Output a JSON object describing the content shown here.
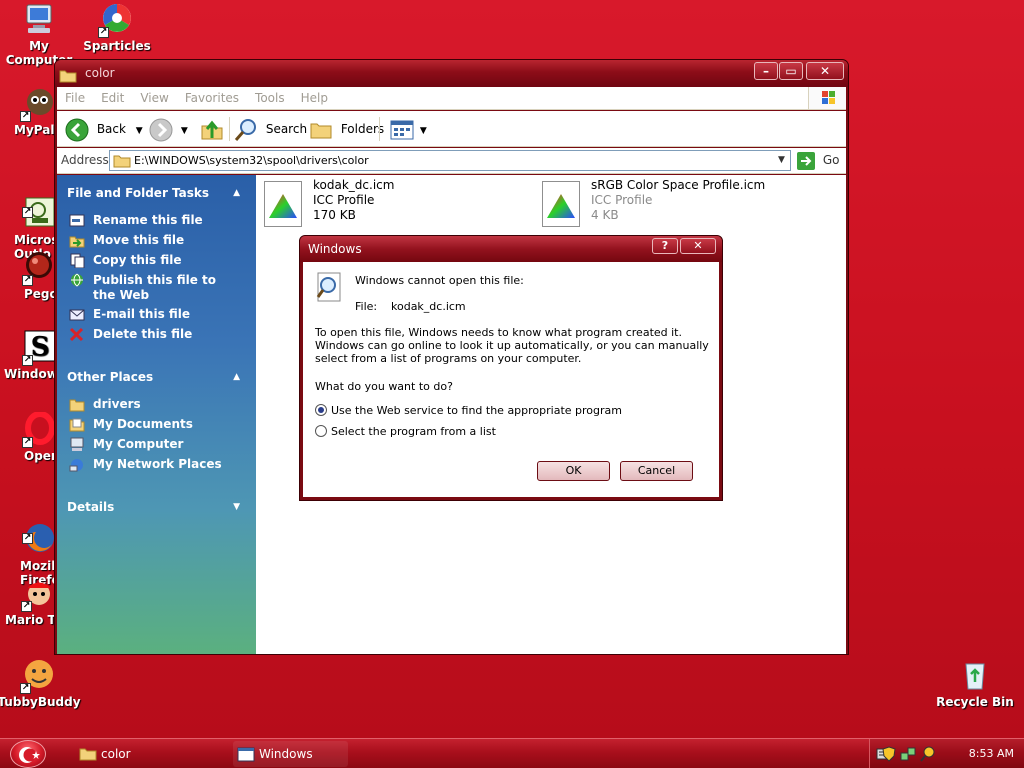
{
  "desktop": {
    "icons": [
      {
        "label": "My Computer"
      },
      {
        "label": "Sparticles"
      },
      {
        "label": "MyPal"
      },
      {
        "label": "Micros\nOutlo"
      },
      {
        "label": "Pego"
      },
      {
        "label": "Windows"
      },
      {
        "label": "Opera"
      },
      {
        "label": "Mozill\nFirefo"
      },
      {
        "label": "Mario Te"
      },
      {
        "label": "TubbyBuddy"
      },
      {
        "label": "Recycle Bin"
      }
    ]
  },
  "explorer": {
    "title": "color",
    "menu": [
      "File",
      "Edit",
      "View",
      "Favorites",
      "Tools",
      "Help"
    ],
    "toolbar": {
      "back": "Back",
      "search": "Search",
      "folders": "Folders"
    },
    "address": {
      "label": "Address",
      "path": "E:\\WINDOWS\\system32\\spool\\drivers\\color",
      "go": "Go"
    },
    "tasks": {
      "file_folder_title": "File and Folder Tasks",
      "file_folder_items": [
        "Rename this file",
        "Move this file",
        "Copy this file",
        "Publish this file to the Web",
        "E-mail this file",
        "Delete this file"
      ],
      "other_places_title": "Other Places",
      "other_places_items": [
        "drivers",
        "My Documents",
        "My Computer",
        "My Network Places"
      ],
      "details_title": "Details"
    },
    "files": [
      {
        "name": "kodak_dc.icm",
        "type": "ICC Profile",
        "size": "170 KB"
      },
      {
        "name": "sRGB Color Space Profile.icm",
        "type": "ICC Profile",
        "size": "4 KB"
      }
    ]
  },
  "dialog": {
    "title": "Windows",
    "intro": "Windows cannot open this file:",
    "file_label": "File:",
    "file_name": "kodak_dc.icm",
    "explanation": "To open this file, Windows needs to know what program created it.  Windows can go online to look it up automatically, or you can manually select from a list of programs on your computer.",
    "question": "What do you want to do?",
    "option_web": "Use the Web service to find the appropriate program",
    "option_list": "Select the program from a list",
    "ok": "OK",
    "cancel": "Cancel"
  },
  "taskbar": {
    "items": [
      "color",
      "Windows"
    ],
    "clock": "8:53 AM"
  },
  "colors": {
    "desktop": "#c8101f",
    "task_pane_top": "#2a5fa8",
    "task_pane_bottom": "#5bb07f"
  }
}
